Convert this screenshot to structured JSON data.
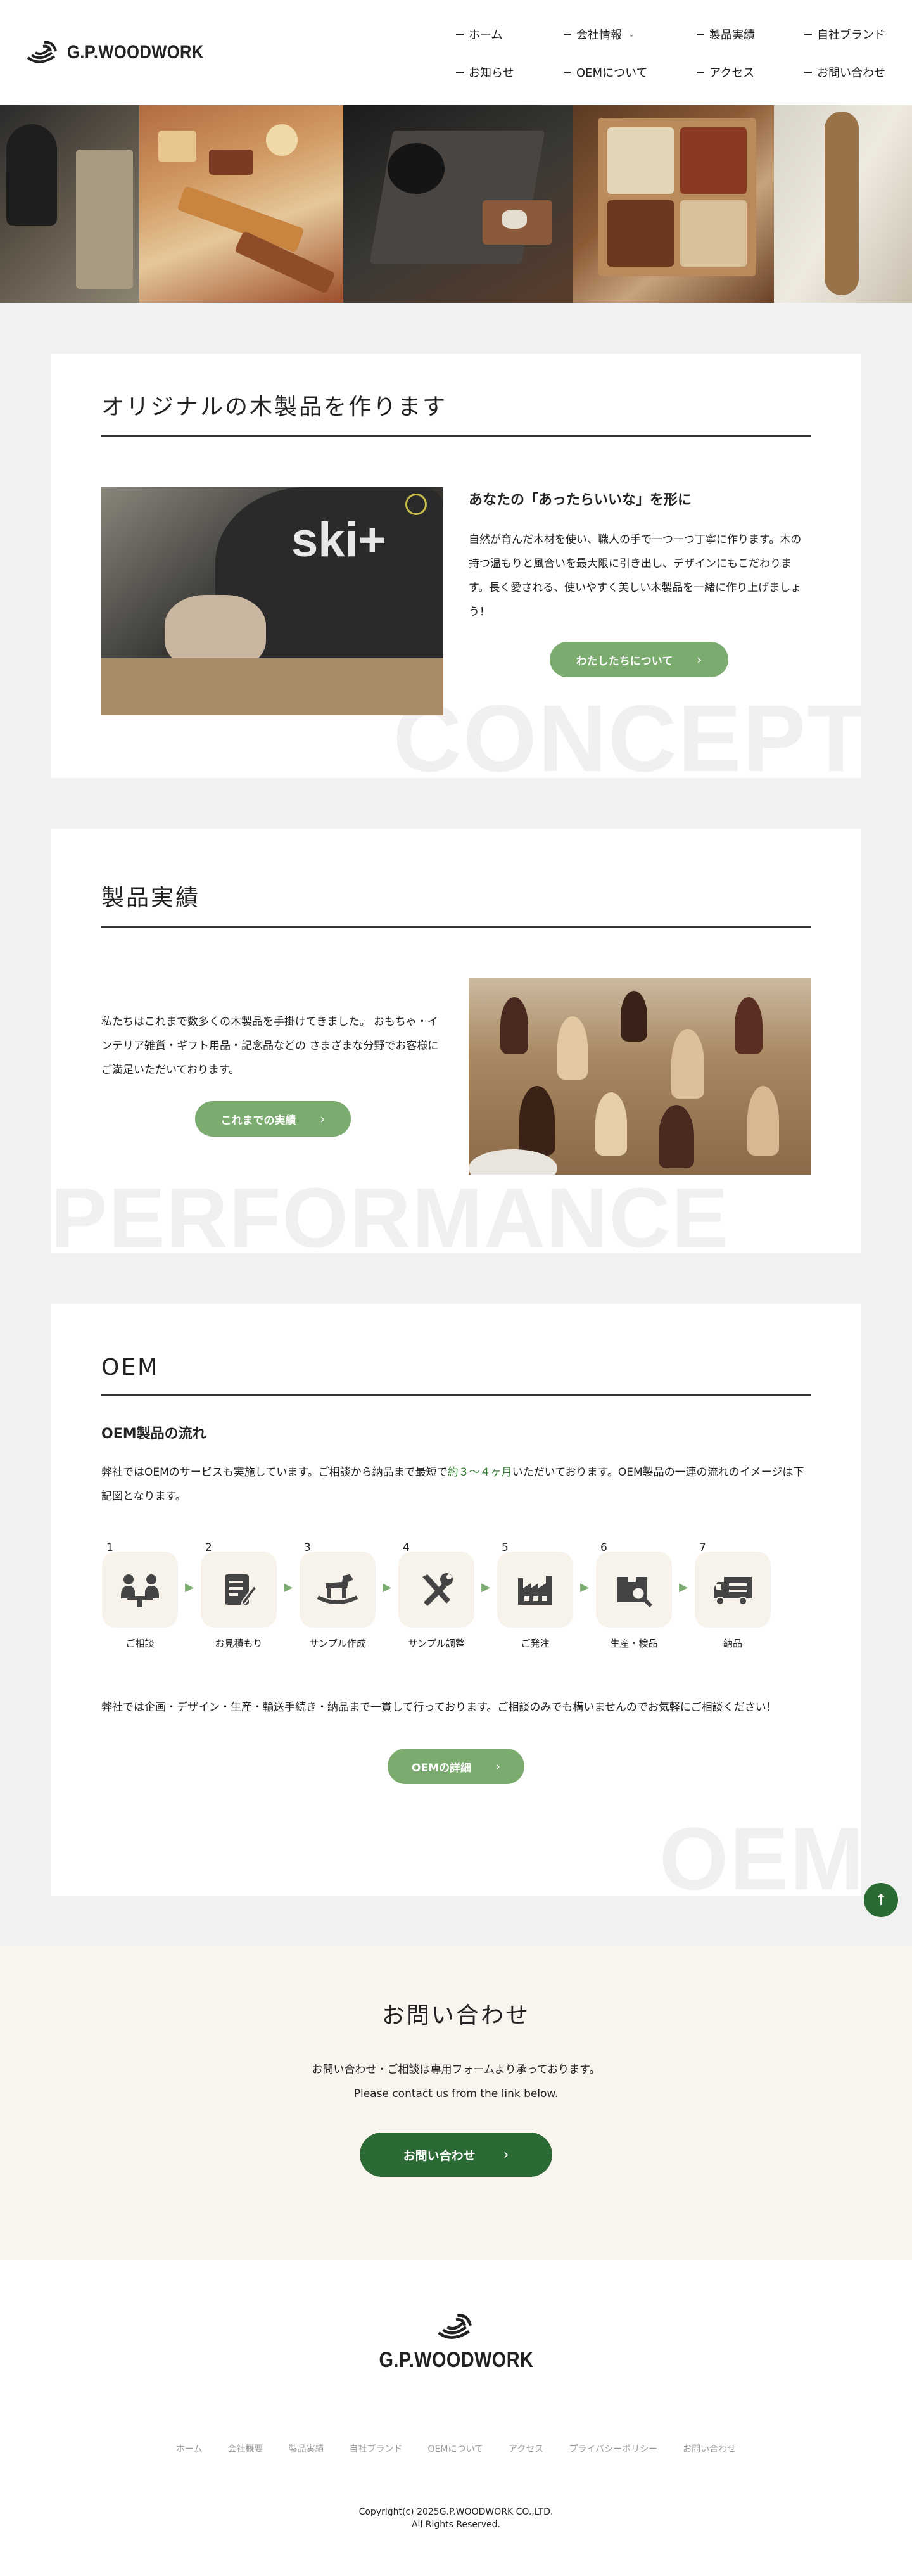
{
  "brand": {
    "name": "G.P.WOODWORK",
    "accent": "#7bab6f",
    "dark_green": "#2c6a35"
  },
  "nav": [
    {
      "label": "ホーム"
    },
    {
      "label": "会社情報",
      "has_dropdown": true
    },
    {
      "label": "製品実績"
    },
    {
      "label": "自社ブランド"
    },
    {
      "label": "お知らせ"
    },
    {
      "label": "OEMについて"
    },
    {
      "label": "アクセス"
    },
    {
      "label": "お問い合わせ"
    }
  ],
  "concept": {
    "title": "オリジナルの木製品を作ります",
    "subtitle": "あなたの「あったらいいな」を形に",
    "body": "自然が育んだ木材を使い、職人の手で一つ一つ丁寧に作ります。木の持つ温もりと風合いを最大限に引き出し、デザインにもこだわります。長く愛される、使いやすく美しい木製品を一緒に作り上げましょう！",
    "button": "わたしたちについて",
    "bg_word": "CONCEPT",
    "photo_text": "ski+"
  },
  "performance": {
    "title": "製品実績",
    "body": "私たちはこれまで数多くの木製品を手掛けてきました。 おもちゃ・インテリア雑貨・ギフト用品・記念品などの さまざまな分野でお客様にご満足いただいております。",
    "button": "これまでの実績",
    "bg_word": "PERFORMANCE"
  },
  "oem": {
    "title": "OEM",
    "subtitle": "OEM製品の流れ",
    "lead_before": "弊社ではOEMのサービスも実施しています。ご相談から納品まで最短で",
    "lead_highlight": "約３～４ヶ月",
    "lead_after": "いただいております。OEM製品の一連の流れのイメージは下記図となります。",
    "steps": [
      {
        "num": "1",
        "label": "ご相談",
        "icon": "meeting-icon"
      },
      {
        "num": "2",
        "label": "お見積もり",
        "icon": "estimate-icon"
      },
      {
        "num": "3",
        "label": "サンプル作成",
        "icon": "rocking-horse-icon"
      },
      {
        "num": "4",
        "label": "サンプル調整",
        "icon": "tools-icon"
      },
      {
        "num": "5",
        "label": "ご発注",
        "icon": "factory-icon"
      },
      {
        "num": "6",
        "label": "生産・検品",
        "icon": "inspection-icon"
      },
      {
        "num": "7",
        "label": "納品",
        "icon": "delivery-truck-icon"
      }
    ],
    "note": "弊社では企画・デザイン・生産・輸送手続き・納品まで一貫して行っております。ご相談のみでも構いませんのでお気軽にご相談ください！",
    "button": "OEMの詳細",
    "bg_word": "OEM"
  },
  "contact": {
    "title": "お問い合わせ",
    "line1": "お問い合わせ・ご相談は専用フォームより承っております。",
    "line2": "Please contact us from the link below.",
    "button": "お問い合わせ"
  },
  "footer": {
    "links": [
      "ホーム",
      "会社概要",
      "製品実績",
      "自社ブランド",
      "OEMについて",
      "アクセス",
      "プライバシーポリシー",
      "お問い合わせ"
    ],
    "copyright1": "Copyright(c) 2025G.P.WOODWORK CO.,LTD.",
    "copyright2": "All Rights Reserved."
  }
}
